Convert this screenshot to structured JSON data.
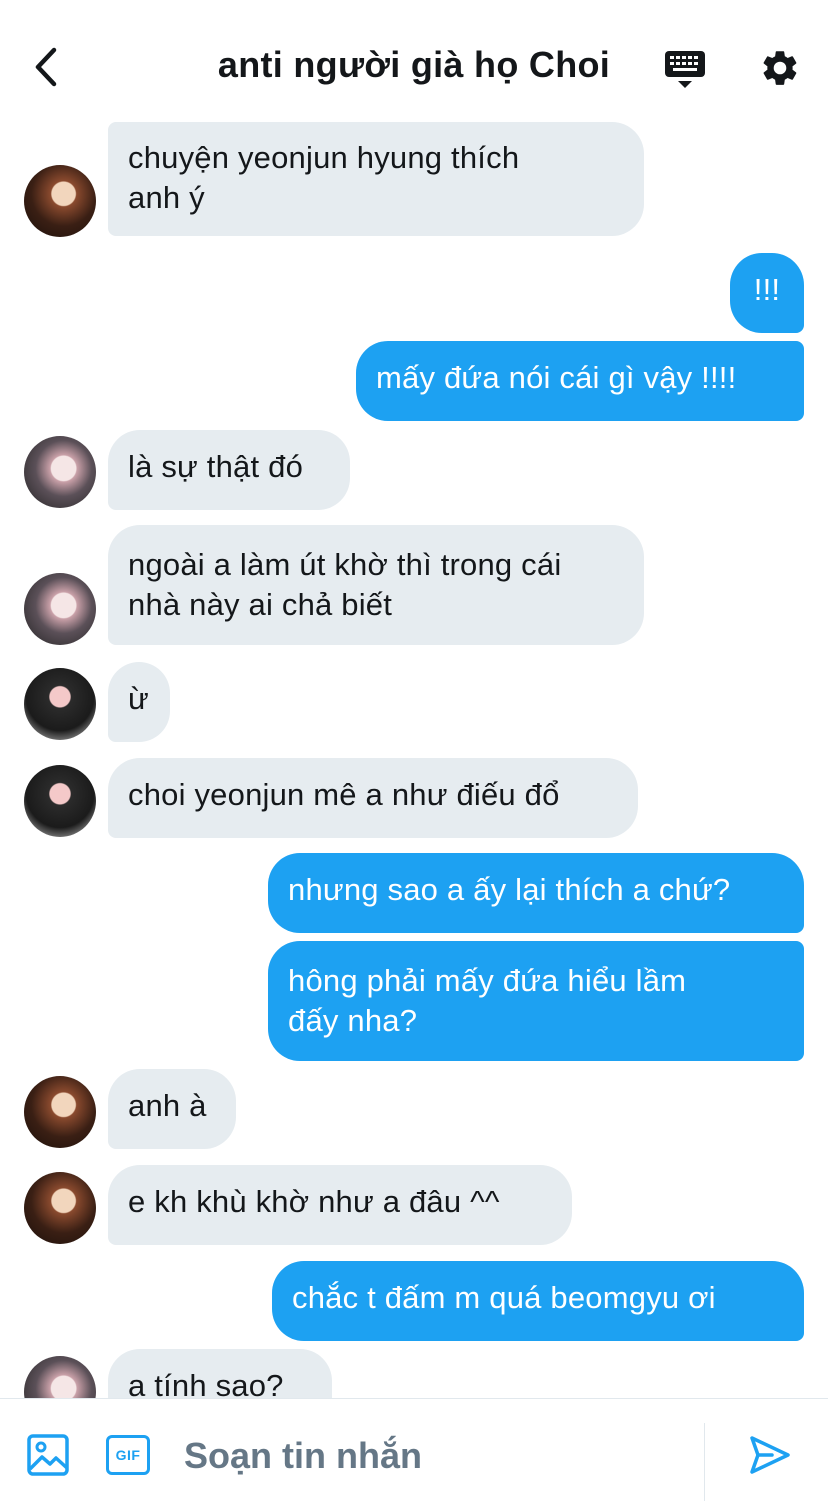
{
  "header": {
    "title": "anti người già họ Choi",
    "back_icon": "chevron-left-icon",
    "keyboard_icon": "keyboard-icon",
    "settings_icon": "gear-icon"
  },
  "messages": [
    {
      "side": "in",
      "avatar": "a",
      "text": "chuyện yeonjun hyung thích\nanh ý"
    },
    {
      "side": "out",
      "text": "!!!"
    },
    {
      "side": "out",
      "text": "mấy đứa nói cái gì vậy !!!!"
    },
    {
      "side": "in",
      "avatar": "b",
      "text": "là sự thật đó"
    },
    {
      "side": "in",
      "avatar": "b",
      "text": "ngoài a làm út khờ thì trong cái\nnhà này ai chả biết"
    },
    {
      "side": "in",
      "avatar": "c",
      "text": "ừ"
    },
    {
      "side": "in",
      "avatar": "c",
      "text": "choi yeonjun mê a như điếu đổ"
    },
    {
      "side": "out",
      "text": "nhưng sao a ấy lại thích a chứ?"
    },
    {
      "side": "out",
      "text": "hông phải mấy đứa hiểu lầm\nđấy nha?"
    },
    {
      "side": "in",
      "avatar": "a",
      "text": "anh à"
    },
    {
      "side": "in",
      "avatar": "a",
      "text": "e kh khù khờ như a đâu ^^"
    },
    {
      "side": "out",
      "text": "chắc t đấm m quá beomgyu ơi"
    },
    {
      "side": "in",
      "avatar": "b",
      "text": "a tính sao?"
    }
  ],
  "composer": {
    "placeholder": "Soạn tin nhắn",
    "gif_label": "GIF",
    "image_icon": "image-icon",
    "send_icon": "send-icon"
  },
  "colors": {
    "accent": "#1da1f2",
    "incoming_bubble": "#e6ecf0",
    "text": "#14171a",
    "placeholder": "#657786"
  }
}
